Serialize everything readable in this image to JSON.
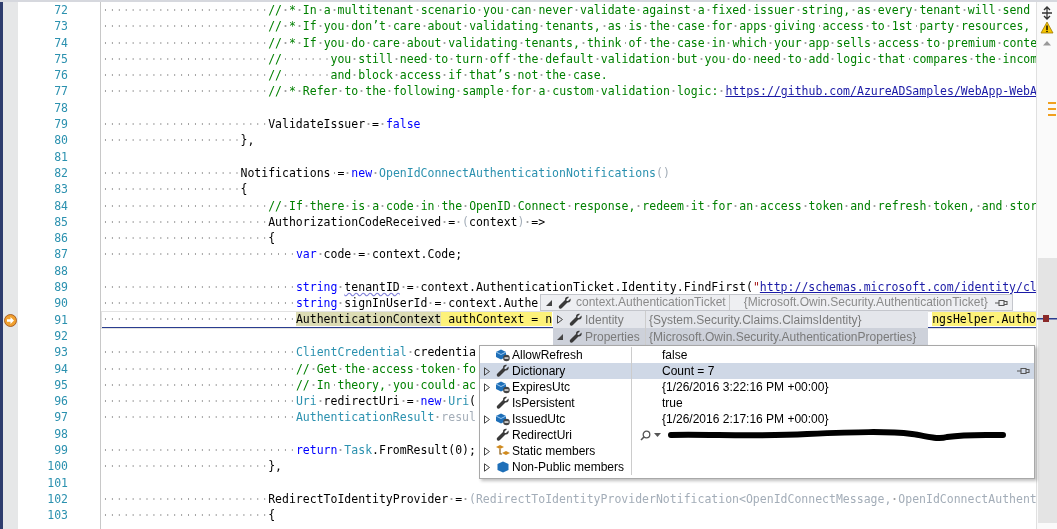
{
  "editor": {
    "lines": [
      {
        "number": "72",
        "tokens": [
          {
            "kind": "comment",
            "text": "                        // * In a multitenant scenario you can never validate against a fixed issuer string, as every tenant will send"
          }
        ]
      },
      {
        "number": "73",
        "tokens": [
          {
            "kind": "comment",
            "text": "                        // * If you don’t care about validating tenants, as is the case for apps giving access to 1st party resources,"
          }
        ]
      },
      {
        "number": "74",
        "tokens": [
          {
            "kind": "comment",
            "text": "                        // * If you do care about validating tenants, think of the case in which your app sells access to premium conte"
          }
        ]
      },
      {
        "number": "75",
        "tokens": [
          {
            "kind": "comment",
            "text": "                        //       you still need to turn off the default validation but you do need to add logic that compares the incom"
          }
        ]
      },
      {
        "number": "76",
        "tokens": [
          {
            "kind": "comment",
            "text": "                        //       and block access if that’s not the case."
          }
        ]
      },
      {
        "number": "77",
        "tokens": [
          {
            "kind": "comment",
            "text": "                        // * Refer to the following sample for a custom validation logic: "
          },
          {
            "kind": "link",
            "text": "https://github.com/AzureADSamples/WebApp-WebA"
          }
        ]
      },
      {
        "number": "78"
      },
      {
        "number": "79",
        "tokens": [
          {
            "kind": "plain",
            "text": "                        ValidateIssuer = "
          },
          {
            "kind": "keyword",
            "text": "false"
          }
        ]
      },
      {
        "number": "80",
        "tokens": [
          {
            "kind": "plain",
            "text": "                    },"
          }
        ]
      },
      {
        "number": "81"
      },
      {
        "number": "82",
        "tokens": [
          {
            "kind": "plain",
            "text": "                    Notifications = "
          },
          {
            "kind": "keyword",
            "text": "new "
          },
          {
            "kind": "type",
            "text": "OpenIdConnectAuthenticationNotifications"
          },
          {
            "kind": "dim",
            "text": "()"
          }
        ]
      },
      {
        "number": "83",
        "tokens": [
          {
            "kind": "plain",
            "text": "                    {"
          }
        ]
      },
      {
        "number": "84",
        "tokens": [
          {
            "kind": "comment",
            "text": "                        // If there is a code in the OpenID Connect response, redeem it for an access token and refresh token, and stor"
          }
        ]
      },
      {
        "number": "85",
        "tokens": [
          {
            "kind": "plain",
            "text": "                        AuthorizationCodeReceived = "
          },
          {
            "kind": "dim",
            "text": "("
          },
          {
            "kind": "plain",
            "text": "context"
          },
          {
            "kind": "dim",
            "text": ")"
          },
          {
            "kind": "plain",
            "text": " =>"
          }
        ]
      },
      {
        "number": "86",
        "tokens": [
          {
            "kind": "plain",
            "text": "                        {"
          }
        ]
      },
      {
        "number": "87",
        "tokens": [
          {
            "kind": "keyword",
            "text": "                            var"
          },
          {
            "kind": "plain",
            "text": " code = context.Code;"
          }
        ]
      },
      {
        "number": "88"
      },
      {
        "number": "89",
        "tokens": [
          {
            "kind": "keyword",
            "text": "                            string "
          },
          {
            "kind": "plain",
            "text": "tenantID",
            "squiggle": true
          },
          {
            "kind": "plain",
            "text": " = context.AuthenticationTicket.Identity.FindFirst("
          },
          {
            "kind": "string",
            "text": "\""
          },
          {
            "kind": "link",
            "text": "http://schemas.microsoft.com/identity/cl"
          }
        ]
      },
      {
        "number": "90",
        "tokens": [
          {
            "kind": "keyword",
            "text": "                            string"
          },
          {
            "kind": "plain",
            "text": " signInUserId = context.Authe"
          }
        ]
      },
      {
        "number": "91",
        "current": true,
        "tokens": [
          {
            "kind": "plain",
            "text": "                            AuthenticationContext",
            "reference": true
          },
          {
            "kind": "plain",
            "text": " authContext = n"
          }
        ],
        "tail": [
          {
            "kind": "plain",
            "text": "ngsHelper.Autho"
          }
        ]
      },
      {
        "number": "92"
      },
      {
        "number": "93",
        "tokens": [
          {
            "kind": "type",
            "text": "                            ClientCredential"
          },
          {
            "kind": "plain",
            "text": " credentia"
          }
        ]
      },
      {
        "number": "94",
        "tokens": [
          {
            "kind": "comment",
            "text": "                            // Get the access token fo"
          }
        ]
      },
      {
        "number": "95",
        "tokens": [
          {
            "kind": "comment",
            "text": "                            // In theory, you could ac"
          }
        ]
      },
      {
        "number": "96",
        "tokens": [
          {
            "kind": "type",
            "text": "                            Uri"
          },
          {
            "kind": "plain",
            "text": " redirectUri = "
          },
          {
            "kind": "keyword",
            "text": "new "
          },
          {
            "kind": "type",
            "text": "Uri"
          },
          {
            "kind": "plain",
            "text": "("
          }
        ]
      },
      {
        "number": "97",
        "tokens": [
          {
            "kind": "type",
            "text": "                            AuthenticationResult"
          },
          {
            "kind": "dim",
            "text": " resul"
          }
        ]
      },
      {
        "number": "98"
      },
      {
        "number": "99",
        "tokens": [
          {
            "kind": "keyword",
            "text": "                            return "
          },
          {
            "kind": "type",
            "text": "Task"
          },
          {
            "kind": "plain",
            "text": ".FromResult(0);"
          }
        ]
      },
      {
        "number": "100",
        "tokens": [
          {
            "kind": "plain",
            "text": "                        },"
          }
        ]
      },
      {
        "number": "101"
      },
      {
        "number": "102",
        "tokens": [
          {
            "kind": "plain",
            "text": "                        RedirectToIdentityProvider = "
          },
          {
            "kind": "dim",
            "text": "(RedirectToIdentityProviderNotification<OpenIdConnectMessage, OpenIdConnectAuthent"
          }
        ]
      },
      {
        "number": "103",
        "tokens": [
          {
            "kind": "plain",
            "text": "                        {"
          }
        ]
      }
    ]
  },
  "datatip": {
    "name": "context.AuthenticationTicket",
    "value": "{Microsoft.Owin.Security.AuthenticationTicket}",
    "expanded": true,
    "pinnable": true,
    "children": [
      {
        "name": "Identity",
        "value": "{System.Security.Claims.ClaimsIdentity}",
        "kind": "property",
        "expanded": false
      },
      {
        "name": "Properties",
        "value": "{Microsoft.Owin.Security.AuthenticationProperties}",
        "kind": "property",
        "expanded": true,
        "children": [
          {
            "name": "AllowRefresh",
            "value": "false",
            "kind": "protected",
            "selected": false
          },
          {
            "name": "Dictionary",
            "value": "Count = 7",
            "kind": "property",
            "expanded": false,
            "selected": true
          },
          {
            "name": "ExpiresUtc",
            "value": "{1/26/2016 3:22:16 PM +00:00}",
            "kind": "protected",
            "expanded": false,
            "selected": false
          },
          {
            "name": "IsPersistent",
            "value": "true",
            "kind": "property",
            "selected": false
          },
          {
            "name": "IssuedUtc",
            "value": "{1/26/2016 2:17:16 PM +00:00}",
            "kind": "protected",
            "expanded": false,
            "selected": false
          },
          {
            "name": "RedirectUri",
            "kind": "property",
            "visualizer": true,
            "redacted": true,
            "selected": false
          },
          {
            "name": "Static members",
            "kind": "static",
            "expanded": false,
            "selected": false
          },
          {
            "name": "Non-Public members",
            "kind": "nonpublic",
            "expanded": false,
            "selected": false
          }
        ]
      }
    ]
  }
}
